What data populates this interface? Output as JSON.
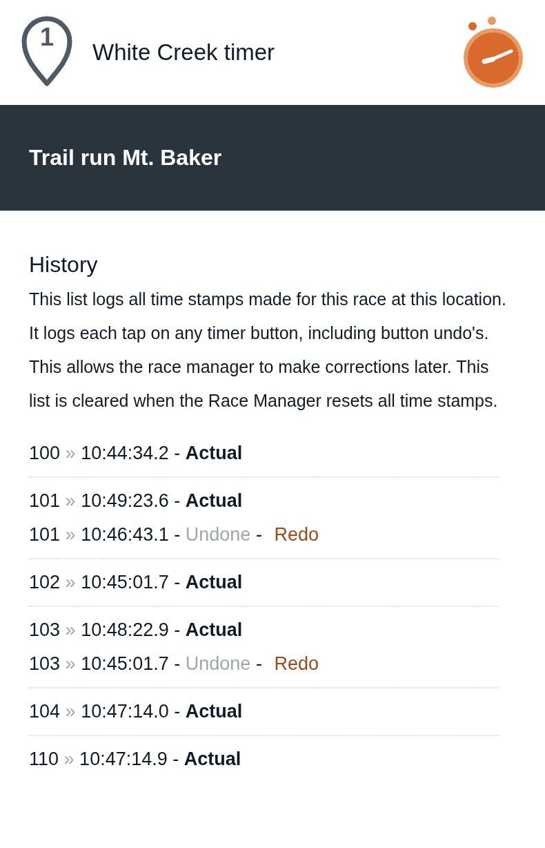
{
  "header": {
    "location_number": "1",
    "title": "White Creek timer"
  },
  "race": {
    "title": "Trail run Mt. Baker"
  },
  "history": {
    "title": "History",
    "description": "This list logs all time stamps made for this race at this location. It logs each tap on any timer button, including button undo's. This allows the race manager to make corrections later. This list is cleared when the Race Manager resets all time stamps.",
    "groups": [
      {
        "entries": [
          {
            "kind": "actual",
            "bib": "100",
            "separator": "»",
            "time": "10:44:34.2",
            "dash": "-",
            "status": "Actual"
          }
        ]
      },
      {
        "entries": [
          {
            "kind": "actual",
            "bib": "101",
            "separator": "»",
            "time": "10:49:23.6",
            "dash": "-",
            "status": "Actual"
          },
          {
            "kind": "undone",
            "bib": "101",
            "separator": "»",
            "time": "10:46:43.1",
            "dash": "-",
            "status": "Undone",
            "action_dash": "-",
            "action": "Redo"
          }
        ]
      },
      {
        "entries": [
          {
            "kind": "actual",
            "bib": "102",
            "separator": "»",
            "time": "10:45:01.7",
            "dash": "-",
            "status": "Actual"
          }
        ]
      },
      {
        "entries": [
          {
            "kind": "actual",
            "bib": "103",
            "separator": "»",
            "time": "10:48:22.9",
            "dash": "-",
            "status": "Actual"
          },
          {
            "kind": "undone",
            "bib": "103",
            "separator": "»",
            "time": "10:45:01.7",
            "dash": "-",
            "status": "Undone",
            "action_dash": "-",
            "action": "Redo"
          }
        ]
      },
      {
        "entries": [
          {
            "kind": "actual",
            "bib": "104",
            "separator": "»",
            "time": "10:47:14.0",
            "dash": "-",
            "status": "Actual"
          }
        ]
      },
      {
        "entries": [
          {
            "kind": "actual",
            "bib": "110",
            "separator": "»",
            "time": "10:47:14.9",
            "dash": "-",
            "status": "Actual"
          }
        ]
      }
    ]
  }
}
